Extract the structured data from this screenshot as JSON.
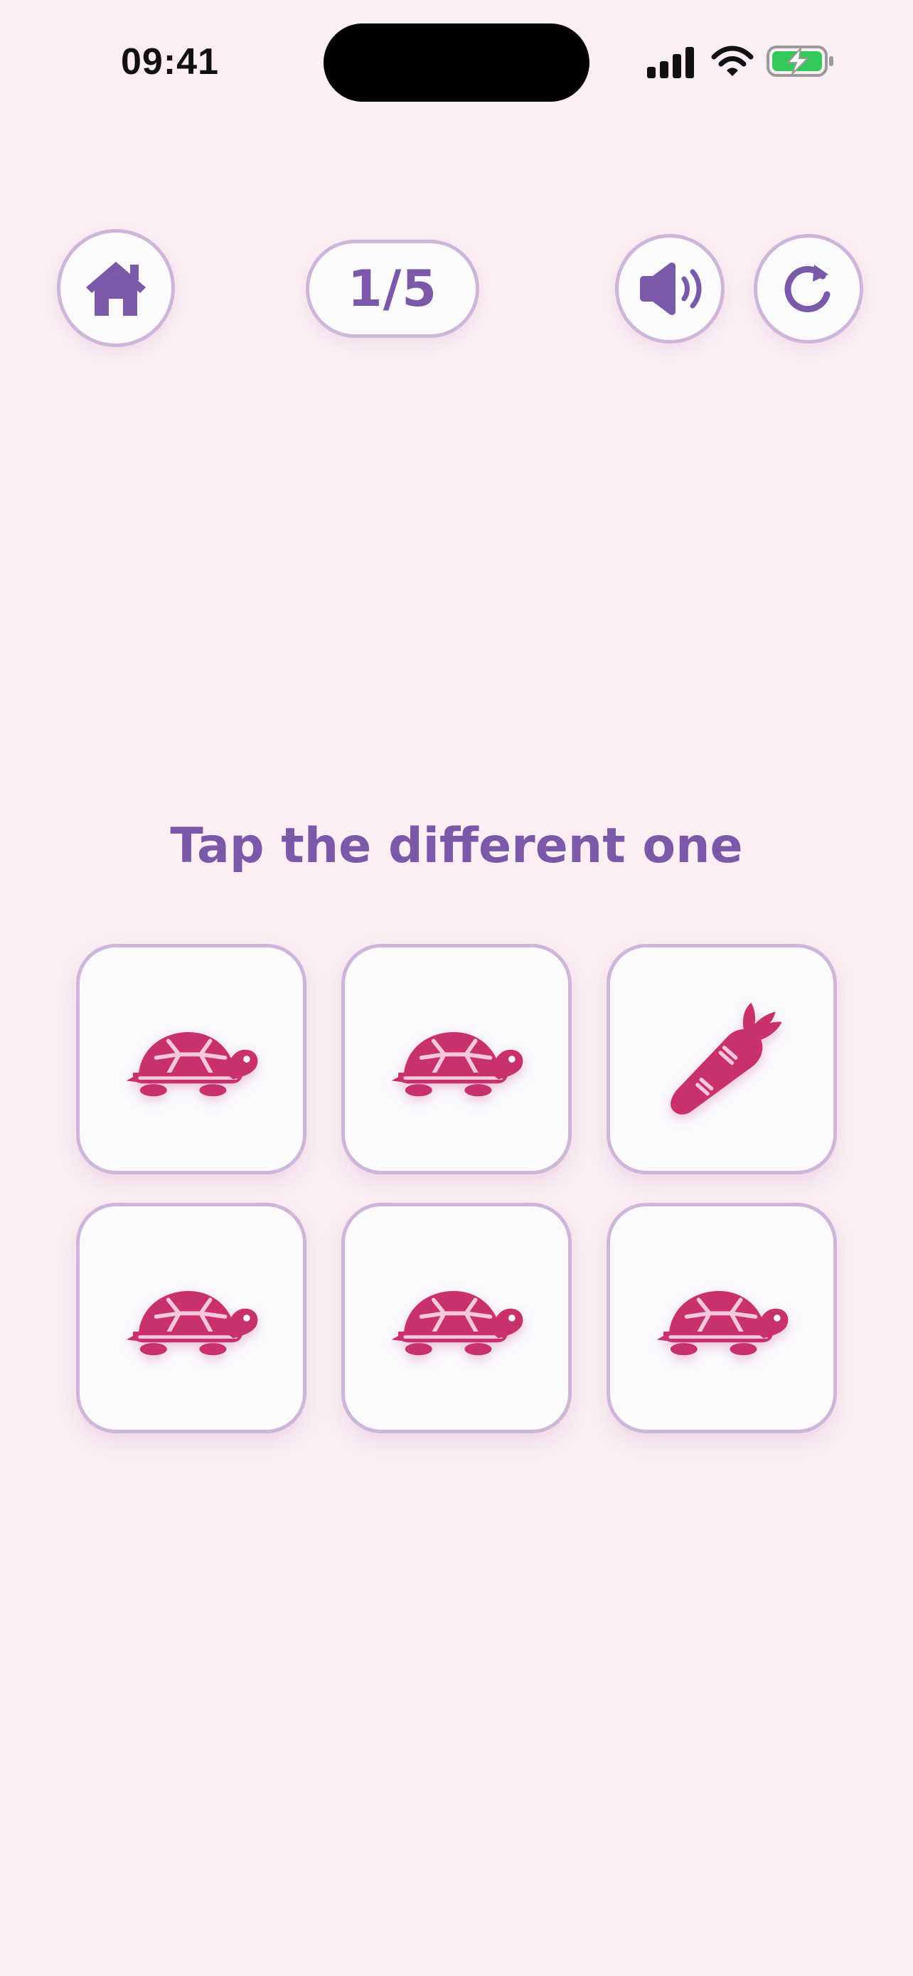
{
  "status_bar": {
    "time": "09:41"
  },
  "header": {
    "home_icon": "home-icon",
    "progress": "1/5",
    "sound_icon": "speaker-icon",
    "replay_icon": "replay-icon"
  },
  "game": {
    "instruction": "Tap the different one",
    "cards": [
      {
        "icon": "turtle-icon"
      },
      {
        "icon": "turtle-icon"
      },
      {
        "icon": "carrot-icon"
      },
      {
        "icon": "turtle-icon"
      },
      {
        "icon": "turtle-icon"
      },
      {
        "icon": "turtle-icon"
      }
    ]
  },
  "colors": {
    "background": "#FCEEF4",
    "accent_purple": "#7A5AA8",
    "border_lilac": "#CDB6DA",
    "icon_magenta": "#C8306E"
  }
}
